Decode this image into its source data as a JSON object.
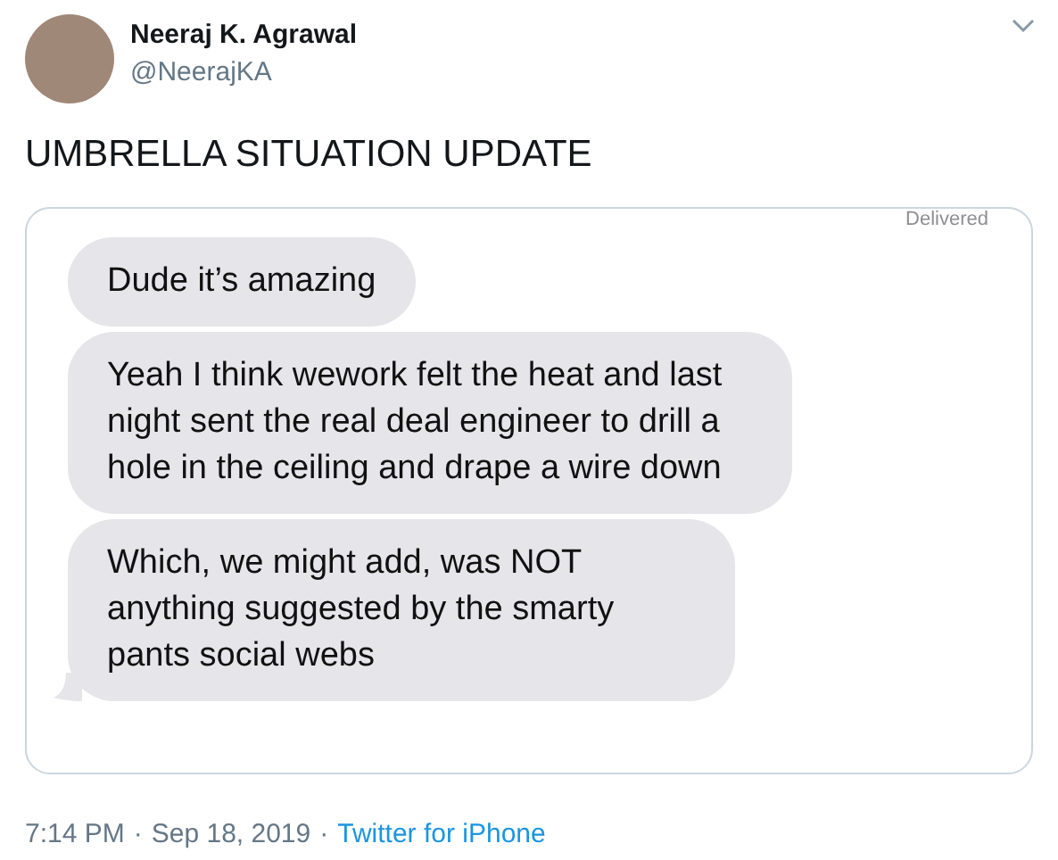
{
  "author": {
    "name": "Neeraj K. Agrawal",
    "handle": "@NeerajKA"
  },
  "tweet_text": "UMBRELLA SITUATION UPDATE",
  "screenshot": {
    "status": "Delivered",
    "messages": [
      "Dude it’s amazing",
      "Yeah I think wework felt the heat and last night sent the real deal engineer to drill a hole in the ceiling and drape a wire down",
      "Which, we might add, was NOT anything suggested by the smarty pants social webs"
    ]
  },
  "footer": {
    "time": "7:14 PM",
    "separator": "·",
    "date": "Sep 18, 2019",
    "separator_2": "·",
    "source": "Twitter for iPhone"
  }
}
